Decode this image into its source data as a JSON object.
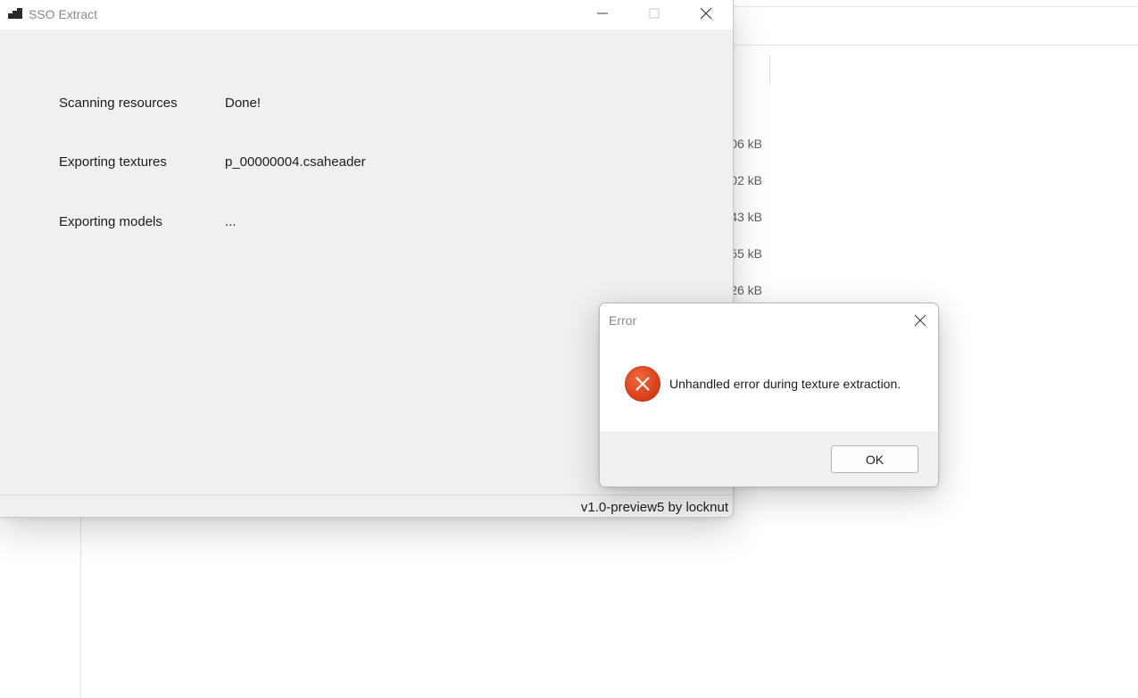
{
  "background": {
    "file_sizes": [
      "06 kB",
      "02 kB",
      "43 kB",
      "55 kB",
      "26 kB"
    ]
  },
  "main_window": {
    "title": "SSO Extract",
    "rows": [
      {
        "label": "Scanning resources",
        "value": "Done!"
      },
      {
        "label": "Exporting textures",
        "value": "p_00000004.csaheader"
      },
      {
        "label": "Exporting models",
        "value": "..."
      }
    ],
    "status_version": "v1.0-preview5 by locknut"
  },
  "dialog": {
    "title": "Error",
    "message": "Unhandled error during texture extraction.",
    "ok_label": "OK",
    "icon": "error-icon",
    "accent_color": "#d8411d"
  }
}
